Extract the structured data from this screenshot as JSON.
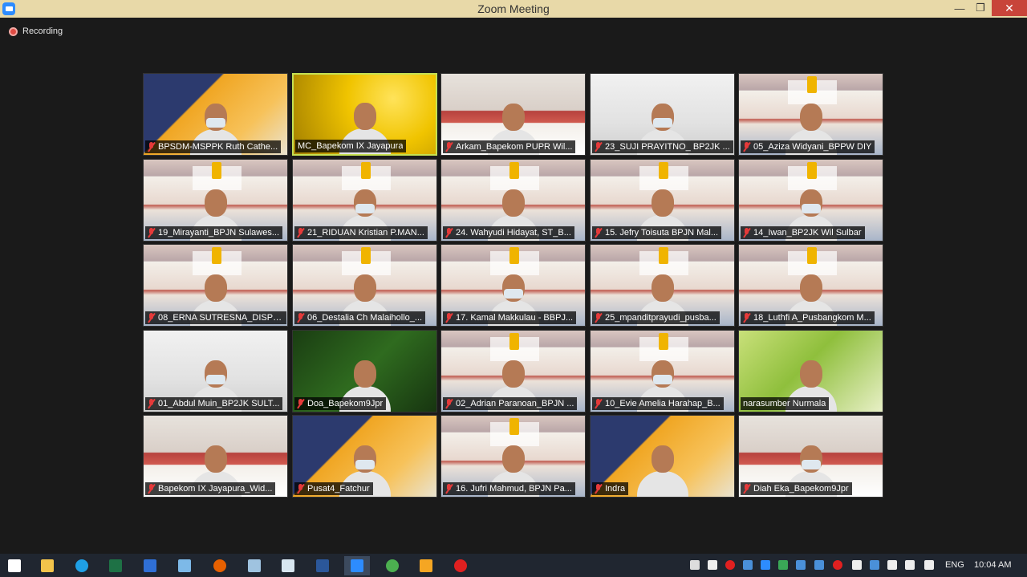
{
  "window": {
    "title": "Zoom Meeting",
    "minimize": "—",
    "maximize": "❐",
    "close": "✕"
  },
  "recording": {
    "label": "Recording"
  },
  "participants": [
    {
      "name": "BPSDM-MSPPK Ruth Cathe...",
      "bg": "orange"
    },
    {
      "name": "MC_Bapekom IX Jayapura",
      "bg": "yellow"
    },
    {
      "name": "Arkam_Bapekom PUPR Wil...",
      "bg": "bapekom"
    },
    {
      "name": "23_SUJI PRAYITNO_ BP2JK ...",
      "bg": "room"
    },
    {
      "name": "05_Aziza Widyani_BPPW DIY",
      "bg": "banner"
    },
    {
      "name": "19_Mirayanti_BPJN Sulawes...",
      "bg": "banner"
    },
    {
      "name": "21_RIDUAN Kristian P.MAN...",
      "bg": "banner"
    },
    {
      "name": "24. Wahyudi Hidayat, ST_B...",
      "bg": "banner"
    },
    {
      "name": "15. Jefry Toisuta BPJN Mal...",
      "bg": "banner"
    },
    {
      "name": "14_Iwan_BP2JK Wil Sulbar",
      "bg": "banner"
    },
    {
      "name": "08_ERNA SUTRESNA_DISPE...",
      "bg": "banner"
    },
    {
      "name": "06_Destalia Ch Malaihollo_...",
      "bg": "banner"
    },
    {
      "name": "17. Kamal Makkulau - BBPJ...",
      "bg": "banner"
    },
    {
      "name": "25_mpanditprayudi_pusba...",
      "bg": "banner"
    },
    {
      "name": "18_Luthfi A_Pusbangkom M...",
      "bg": "banner"
    },
    {
      "name": "01_Abdul Muin_BP2JK SULT...",
      "bg": "room"
    },
    {
      "name": "Doa_Bapekom9Jpr",
      "bg": "green"
    },
    {
      "name": "02_Adrian Paranoan_BPJN ...",
      "bg": "banner"
    },
    {
      "name": "10_Evie Amelia Harahap_B...",
      "bg": "banner"
    },
    {
      "name": "narasumber Nurmala",
      "bg": "grass"
    },
    {
      "name": "Bapekom IX Jayapura_Wid...",
      "bg": "bapekom"
    },
    {
      "name": "Pusat4_Fatchur",
      "bg": "orange"
    },
    {
      "name": "16. Jufri Mahmud, BPJN Pa...",
      "bg": "banner"
    },
    {
      "name": "Indra",
      "bg": "orange"
    },
    {
      "name": "Diah Eka_Bapekom9Jpr",
      "bg": "bapekom"
    }
  ],
  "taskbar": {
    "apps": [
      "windows-start",
      "file-explorer",
      "internet-explorer",
      "excel",
      "windows-defender",
      "network-tool",
      "firefox",
      "notepad",
      "notes",
      "word",
      "zoom",
      "chrome",
      "media-player",
      "opera"
    ],
    "active_app": "zoom",
    "language": "ENG",
    "time": "10:04 AM"
  }
}
